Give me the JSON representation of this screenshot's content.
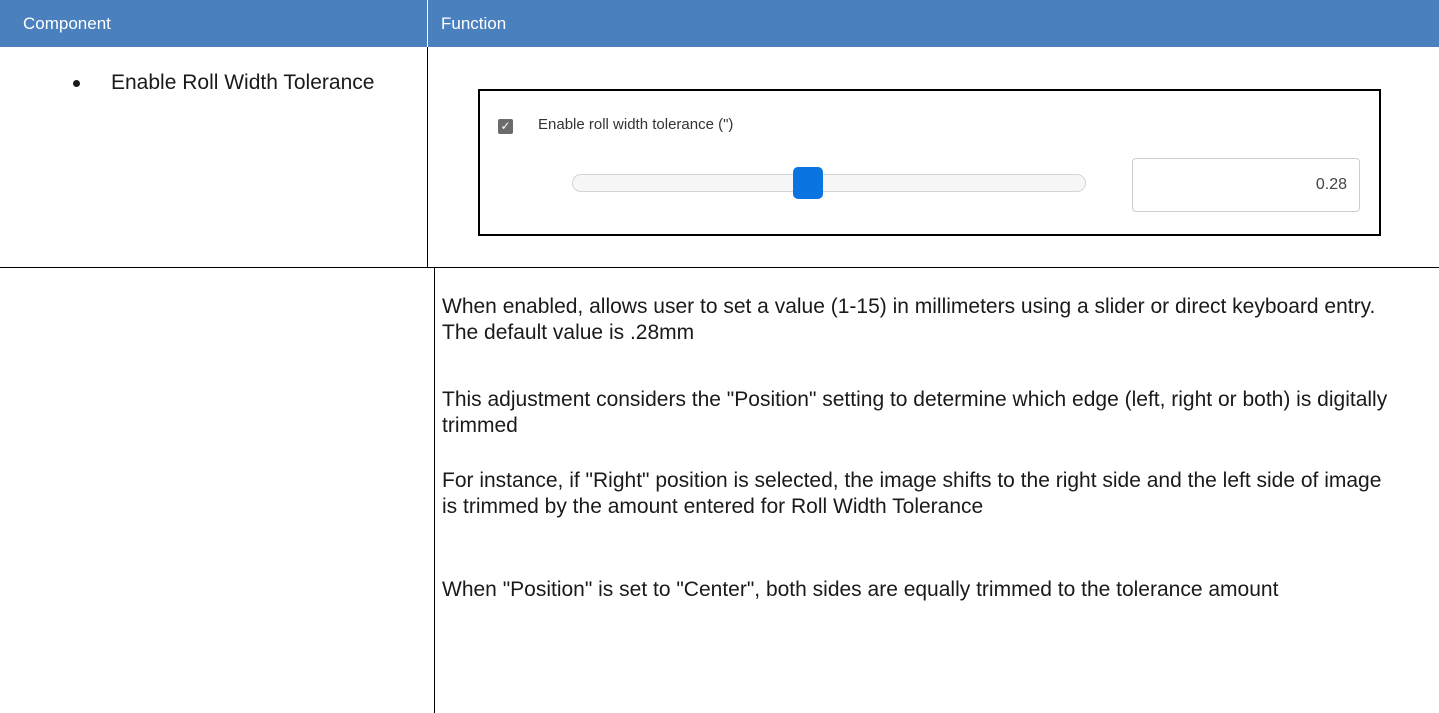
{
  "header": {
    "col1": "Component",
    "col2": "Function"
  },
  "component": {
    "bullet": "Enable Roll Width Tolerance"
  },
  "screenshot": {
    "checkbox_checked": true,
    "checkbox_label": "Enable roll width tolerance (\")",
    "slider_value_fraction": 0.46,
    "value": "0.28",
    "accent_color": "#0a74e0"
  },
  "function": {
    "p1": "When enabled, allows user to set a value (1-15) in millimeters using a slider or direct keyboard entry. The default value is .28mm",
    "p2": "This adjustment considers the \"Position\" setting to determine which edge (left, right or both) is digitally trimmed",
    "p3": "For instance, if \"Right\" position is selected, the image shifts to the right side and the left side of image is trimmed by the amount entered for Roll Width Tolerance",
    "p4": "When \"Position\" is set to \"Center\", both sides are equally trimmed to the tolerance amount"
  },
  "colors": {
    "header_bg": "#4a80be",
    "header_text": "#ffffff"
  }
}
